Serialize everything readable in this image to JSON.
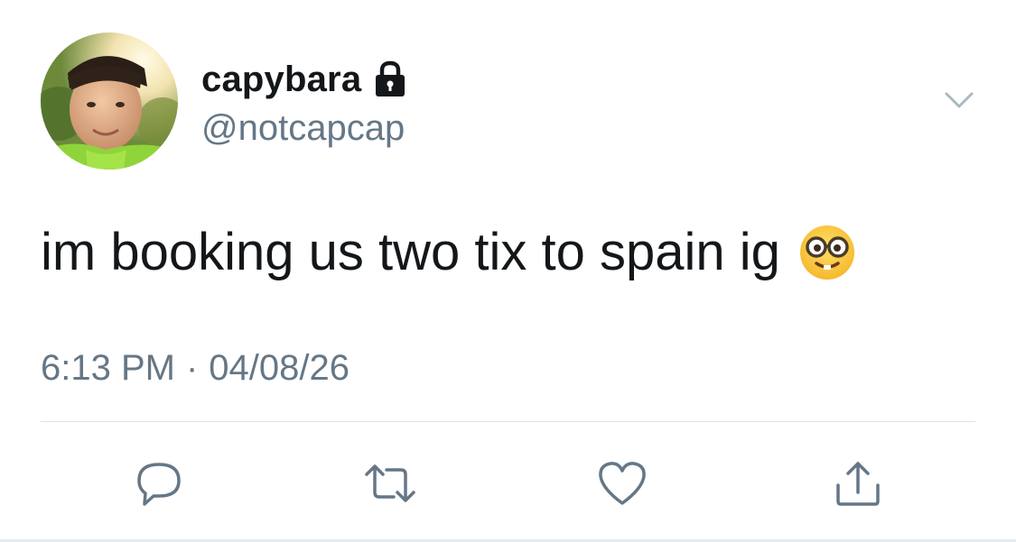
{
  "tweet": {
    "display_name": "capybara",
    "handle": "@notcapcap",
    "text": "im booking us two tix to spain ig",
    "time": "6:13 PM",
    "separator": "·",
    "date": "04/08/26",
    "icons": {
      "avatar": "profile-photo",
      "protected": "lock-icon",
      "menu": "chevron-down-icon",
      "emoji": "nerd-face-emoji"
    }
  },
  "actions": [
    {
      "name": "reply",
      "icon": "speech-bubble-icon"
    },
    {
      "name": "retweet",
      "icon": "retweet-arrows-icon"
    },
    {
      "name": "like",
      "icon": "heart-icon"
    },
    {
      "name": "share",
      "icon": "share-upload-icon"
    }
  ],
  "colors": {
    "text": "#14171a",
    "secondary": "#657786",
    "icon": "#657786",
    "divider": "#dfe3e6"
  }
}
